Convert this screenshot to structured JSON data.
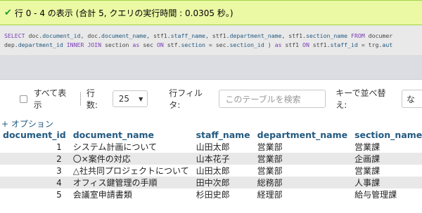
{
  "message": {
    "text": "行 0 - 4 の表示 (合計 5, クエリの実行時間 : 0.0305 秒。)",
    "icon": "check-icon"
  },
  "sql": {
    "line1": [
      {
        "t": "SELECT",
        "c": "kw"
      },
      {
        "t": " doc.",
        "c": ""
      },
      {
        "t": "document_id",
        "c": "col"
      },
      {
        "t": ", doc.",
        "c": ""
      },
      {
        "t": "document_name",
        "c": "col"
      },
      {
        "t": ", stf1.",
        "c": ""
      },
      {
        "t": "staff_name",
        "c": "col"
      },
      {
        "t": ", stf1.",
        "c": ""
      },
      {
        "t": "department_name",
        "c": "col"
      },
      {
        "t": ", stf1.",
        "c": ""
      },
      {
        "t": "section_name",
        "c": "col"
      },
      {
        "t": " ",
        "c": ""
      },
      {
        "t": "FROM",
        "c": "kw"
      },
      {
        "t": " documer",
        "c": ""
      }
    ],
    "line2": [
      {
        "t": "dep.",
        "c": ""
      },
      {
        "t": "department_id",
        "c": "col"
      },
      {
        "t": " ",
        "c": ""
      },
      {
        "t": "INNER JOIN",
        "c": "kw"
      },
      {
        "t": " section ",
        "c": ""
      },
      {
        "t": "as",
        "c": "kw"
      },
      {
        "t": " sec ",
        "c": ""
      },
      {
        "t": "ON",
        "c": "kw"
      },
      {
        "t": " stf.",
        "c": ""
      },
      {
        "t": "section",
        "c": "col"
      },
      {
        "t": " = sec.",
        "c": ""
      },
      {
        "t": "section_id",
        "c": "col"
      },
      {
        "t": " ) ",
        "c": ""
      },
      {
        "t": "as",
        "c": "kw"
      },
      {
        "t": " stf1 ",
        "c": ""
      },
      {
        "t": "ON",
        "c": "kw"
      },
      {
        "t": " stf1.",
        "c": ""
      },
      {
        "t": "staff_id",
        "c": "col"
      },
      {
        "t": " = trg.",
        "c": ""
      },
      {
        "t": "aut",
        "c": "col"
      }
    ]
  },
  "toolbar": {
    "show_all_label": "すべて表示",
    "rows_label": "行数:",
    "rows_value": "25",
    "filter_label": "行フィルタ:",
    "filter_placeholder": "このテーブルを検索",
    "sort_label": "キーで並べ替え:",
    "sort_value": "な"
  },
  "options_link": "+ オプション",
  "table": {
    "columns": [
      "document_id",
      "document_name",
      "staff_name",
      "department_name",
      "section_name"
    ],
    "rows": [
      [
        "1",
        "システム計画について",
        "山田太郎",
        "営業部",
        "営業課"
      ],
      [
        "2",
        "〇×案件の対応",
        "山本花子",
        "営業部",
        "企画課"
      ],
      [
        "3",
        "△社共同プロジェクトについて",
        "山田太郎",
        "営業部",
        "営業課"
      ],
      [
        "4",
        "オフィス鍵管理の手順",
        "田中次郎",
        "総務部",
        "人事課"
      ],
      [
        "5",
        "会議室申請書類",
        "杉田史郎",
        "経理部",
        "給与管理課"
      ]
    ]
  },
  "colors": {
    "success_bg": "#ebf8a4",
    "link": "#235a81",
    "sql_keyword": "#7a3eb5"
  }
}
